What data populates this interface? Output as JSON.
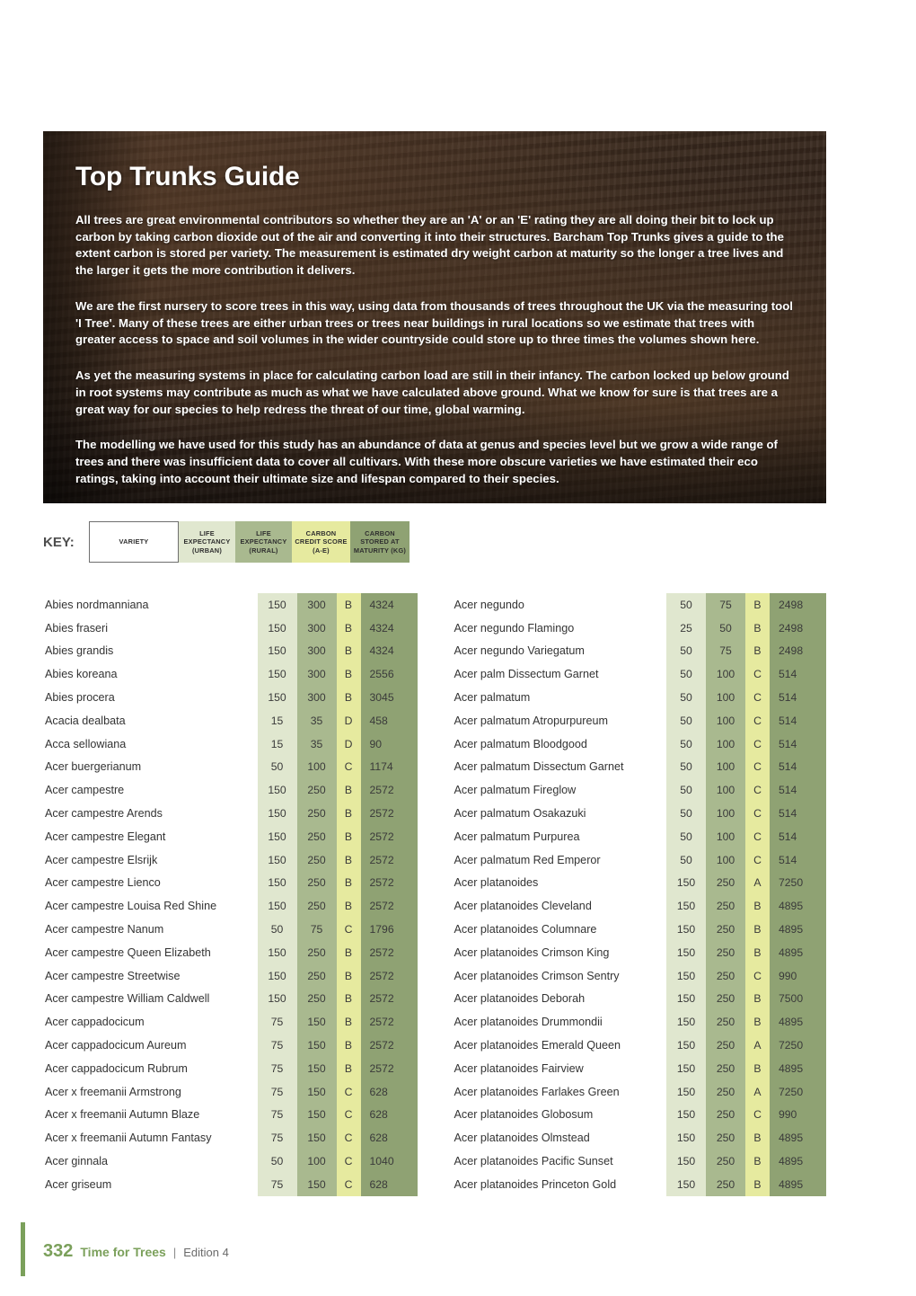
{
  "hero": {
    "title": "Top Trunks Guide",
    "paragraphs": [
      "All trees are great environmental contributors so whether they are an 'A' or an 'E' rating they are all doing their bit to lock up carbon by taking carbon dioxide out of the air and converting it into their structures. Barcham Top Trunks gives a guide to the extent carbon is stored per variety. The measurement is estimated dry weight carbon at maturity so the longer a tree lives and the larger it gets the more contribution it delivers.",
      "We are the first nursery to score trees in this way, using data from thousands of trees throughout the UK via the measuring tool 'I Tree'. Many of these trees are either urban trees or trees near buildings in rural locations so we estimate that trees with greater access to space and soil volumes in the wider countryside could store up to three times the volumes shown here.",
      "As yet the measuring systems in place for calculating carbon load are still in their infancy. The carbon locked up below ground in root systems may contribute as much as what we have calculated above ground. What we know for sure is that trees are a great way for our species to help redress the threat of our time, global warming.",
      "The modelling we have used for this study has an abundance of data at genus and species level but we grow a wide range of trees and there was insufficient data to cover all cultivars. With these more obscure varieties we have estimated their eco ratings, taking into account their ultimate size and lifespan compared to their species."
    ]
  },
  "key": {
    "label": "KEY:",
    "cells": [
      "VARIETY",
      "LIFE\nEXPECTANCY\n(URBAN)",
      "LIFE\nEXPECTANCY\n(RURAL)",
      "CARBON\nCREDIT SCORE\n(A-E)",
      "CARBON\nSTORED AT\nMATURITY (KG)"
    ],
    "colors": {
      "variety": "#ffffff",
      "urban": "#e0e7cf",
      "rural": "#a9b98f",
      "score": "#e6ea9f",
      "stored": "#8fa273"
    }
  },
  "table": {
    "left": [
      {
        "name": "Abies nordmanniana",
        "urban": "150",
        "rural": "300",
        "score": "B",
        "stored": "4324"
      },
      {
        "name": "Abies fraseri",
        "urban": "150",
        "rural": "300",
        "score": "B",
        "stored": "4324"
      },
      {
        "name": "Abies grandis",
        "urban": "150",
        "rural": "300",
        "score": "B",
        "stored": "4324"
      },
      {
        "name": "Abies koreana",
        "urban": "150",
        "rural": "300",
        "score": "B",
        "stored": "2556"
      },
      {
        "name": "Abies procera",
        "urban": "150",
        "rural": "300",
        "score": "B",
        "stored": "3045"
      },
      {
        "name": "Acacia dealbata",
        "urban": "15",
        "rural": "35",
        "score": "D",
        "stored": "458"
      },
      {
        "name": "Acca sellowiana",
        "urban": "15",
        "rural": "35",
        "score": "D",
        "stored": "90"
      },
      {
        "name": "Acer buergerianum",
        "urban": "50",
        "rural": "100",
        "score": "C",
        "stored": "1174"
      },
      {
        "name": "Acer campestre",
        "urban": "150",
        "rural": "250",
        "score": "B",
        "stored": "2572"
      },
      {
        "name": "Acer campestre Arends",
        "urban": "150",
        "rural": "250",
        "score": "B",
        "stored": "2572"
      },
      {
        "name": "Acer campestre Elegant",
        "urban": "150",
        "rural": "250",
        "score": "B",
        "stored": "2572"
      },
      {
        "name": "Acer campestre Elsrijk",
        "urban": "150",
        "rural": "250",
        "score": "B",
        "stored": "2572"
      },
      {
        "name": "Acer campestre Lienco",
        "urban": "150",
        "rural": "250",
        "score": "B",
        "stored": "2572"
      },
      {
        "name": "Acer campestre Louisa Red Shine",
        "urban": "150",
        "rural": "250",
        "score": "B",
        "stored": "2572"
      },
      {
        "name": "Acer campestre Nanum",
        "urban": "50",
        "rural": "75",
        "score": "C",
        "stored": "1796"
      },
      {
        "name": "Acer campestre Queen Elizabeth",
        "urban": "150",
        "rural": "250",
        "score": "B",
        "stored": "2572"
      },
      {
        "name": "Acer campestre Streetwise",
        "urban": "150",
        "rural": "250",
        "score": "B",
        "stored": "2572"
      },
      {
        "name": "Acer campestre William Caldwell",
        "urban": "150",
        "rural": "250",
        "score": "B",
        "stored": "2572"
      },
      {
        "name": "Acer cappadocicum",
        "urban": "75",
        "rural": "150",
        "score": "B",
        "stored": "2572"
      },
      {
        "name": "Acer cappadocicum Aureum",
        "urban": "75",
        "rural": "150",
        "score": "B",
        "stored": "2572"
      },
      {
        "name": "Acer cappadocicum Rubrum",
        "urban": "75",
        "rural": "150",
        "score": "B",
        "stored": "2572"
      },
      {
        "name": "Acer x freemanii Armstrong",
        "urban": "75",
        "rural": "150",
        "score": "C",
        "stored": "628"
      },
      {
        "name": "Acer x freemanii Autumn Blaze",
        "urban": "75",
        "rural": "150",
        "score": "C",
        "stored": "628"
      },
      {
        "name": "Acer x freemanii Autumn Fantasy",
        "urban": "75",
        "rural": "150",
        "score": "C",
        "stored": "628"
      },
      {
        "name": "Acer ginnala",
        "urban": "50",
        "rural": "100",
        "score": "C",
        "stored": "1040"
      },
      {
        "name": "Acer griseum",
        "urban": "75",
        "rural": "150",
        "score": "C",
        "stored": "628"
      }
    ],
    "right": [
      {
        "name": "Acer negundo",
        "urban": "50",
        "rural": "75",
        "score": "B",
        "stored": "2498"
      },
      {
        "name": "Acer negundo Flamingo",
        "urban": "25",
        "rural": "50",
        "score": "B",
        "stored": "2498"
      },
      {
        "name": "Acer negundo Variegatum",
        "urban": "50",
        "rural": "75",
        "score": "B",
        "stored": "2498"
      },
      {
        "name": "Acer palm Dissectum Garnet",
        "urban": "50",
        "rural": "100",
        "score": "C",
        "stored": "514"
      },
      {
        "name": "Acer palmatum",
        "urban": "50",
        "rural": "100",
        "score": "C",
        "stored": "514"
      },
      {
        "name": "Acer palmatum Atropurpureum",
        "urban": "50",
        "rural": "100",
        "score": "C",
        "stored": "514"
      },
      {
        "name": "Acer palmatum Bloodgood",
        "urban": "50",
        "rural": "100",
        "score": "C",
        "stored": "514"
      },
      {
        "name": "Acer palmatum Dissectum Garnet",
        "urban": "50",
        "rural": "100",
        "score": "C",
        "stored": "514"
      },
      {
        "name": "Acer palmatum Fireglow",
        "urban": "50",
        "rural": "100",
        "score": "C",
        "stored": "514"
      },
      {
        "name": "Acer palmatum Osakazuki",
        "urban": "50",
        "rural": "100",
        "score": "C",
        "stored": "514"
      },
      {
        "name": "Acer palmatum Purpurea",
        "urban": "50",
        "rural": "100",
        "score": "C",
        "stored": "514"
      },
      {
        "name": "Acer palmatum Red Emperor",
        "urban": "50",
        "rural": "100",
        "score": "C",
        "stored": "514"
      },
      {
        "name": "Acer platanoides",
        "urban": "150",
        "rural": "250",
        "score": "A",
        "stored": "7250"
      },
      {
        "name": "Acer platanoides Cleveland",
        "urban": "150",
        "rural": "250",
        "score": "B",
        "stored": "4895"
      },
      {
        "name": "Acer platanoides Columnare",
        "urban": "150",
        "rural": "250",
        "score": "B",
        "stored": "4895"
      },
      {
        "name": "Acer platanoides Crimson King",
        "urban": "150",
        "rural": "250",
        "score": "B",
        "stored": "4895"
      },
      {
        "name": "Acer platanoides Crimson Sentry",
        "urban": "150",
        "rural": "250",
        "score": "C",
        "stored": "990"
      },
      {
        "name": "Acer platanoides Deborah",
        "urban": "150",
        "rural": "250",
        "score": "B",
        "stored": "7500"
      },
      {
        "name": "Acer platanoides Drummondii",
        "urban": "150",
        "rural": "250",
        "score": "B",
        "stored": "4895"
      },
      {
        "name": "Acer platanoides Emerald Queen",
        "urban": "150",
        "rural": "250",
        "score": "A",
        "stored": "7250"
      },
      {
        "name": "Acer platanoides Fairview",
        "urban": "150",
        "rural": "250",
        "score": "B",
        "stored": "4895"
      },
      {
        "name": "Acer platanoides Farlakes Green",
        "urban": "150",
        "rural": "250",
        "score": "A",
        "stored": "7250"
      },
      {
        "name": "Acer platanoides Globosum",
        "urban": "150",
        "rural": "250",
        "score": "C",
        "stored": "990"
      },
      {
        "name": "Acer platanoides Olmstead",
        "urban": "150",
        "rural": "250",
        "score": "B",
        "stored": "4895"
      },
      {
        "name": "Acer platanoides Pacific Sunset",
        "urban": "150",
        "rural": "250",
        "score": "B",
        "stored": "4895"
      },
      {
        "name": "Acer platanoides Princeton Gold",
        "urban": "150",
        "rural": "250",
        "score": "B",
        "stored": "4895"
      }
    ]
  },
  "footer": {
    "page": "332",
    "title": "Time for Trees",
    "separator": "|",
    "edition": "Edition 4",
    "accent": "#7ba05b"
  }
}
